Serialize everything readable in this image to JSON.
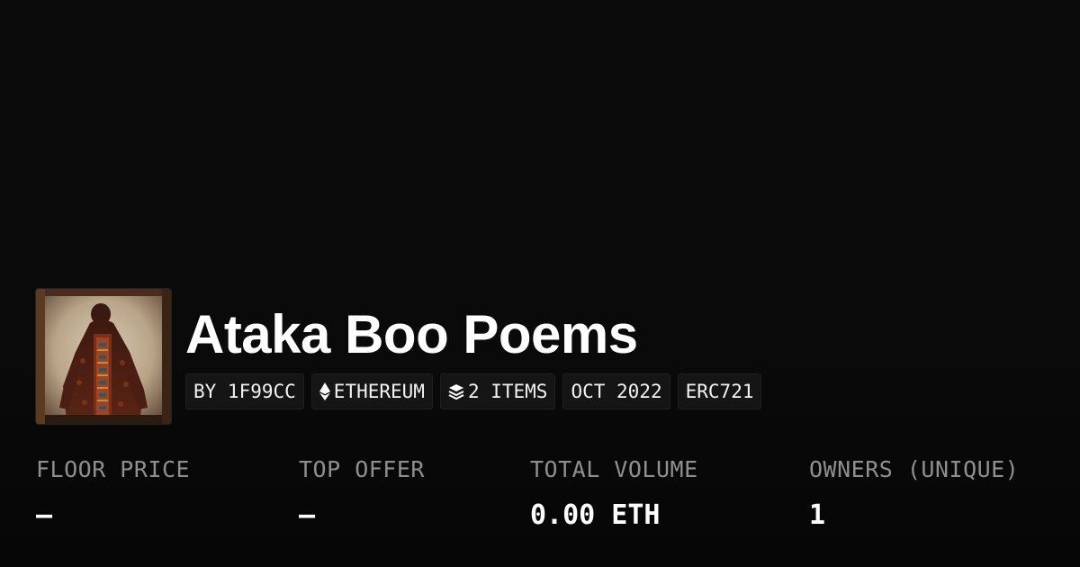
{
  "collection": {
    "name": "Ataka Boo Poems",
    "tags": [
      {
        "icon": "",
        "label": "BY 1F99CC"
      },
      {
        "icon": "ethereum-icon",
        "label": "ETHEREUM"
      },
      {
        "icon": "layers-icon",
        "label": "2 ITEMS"
      },
      {
        "icon": "",
        "label": "OCT 2022"
      },
      {
        "icon": "",
        "label": "ERC721"
      }
    ]
  },
  "stats": [
    {
      "label": "FLOOR PRICE",
      "value": "–"
    },
    {
      "label": "TOP OFFER",
      "value": "–"
    },
    {
      "label": "TOTAL VOLUME",
      "value": "0.00 ETH"
    },
    {
      "label": "OWNERS (UNIQUE)",
      "value": "1"
    }
  ],
  "colors": {
    "background": "#0a0a0a",
    "tag_background": "#151515",
    "label_gray": "#8f8f8f",
    "text": "#ffffff"
  }
}
